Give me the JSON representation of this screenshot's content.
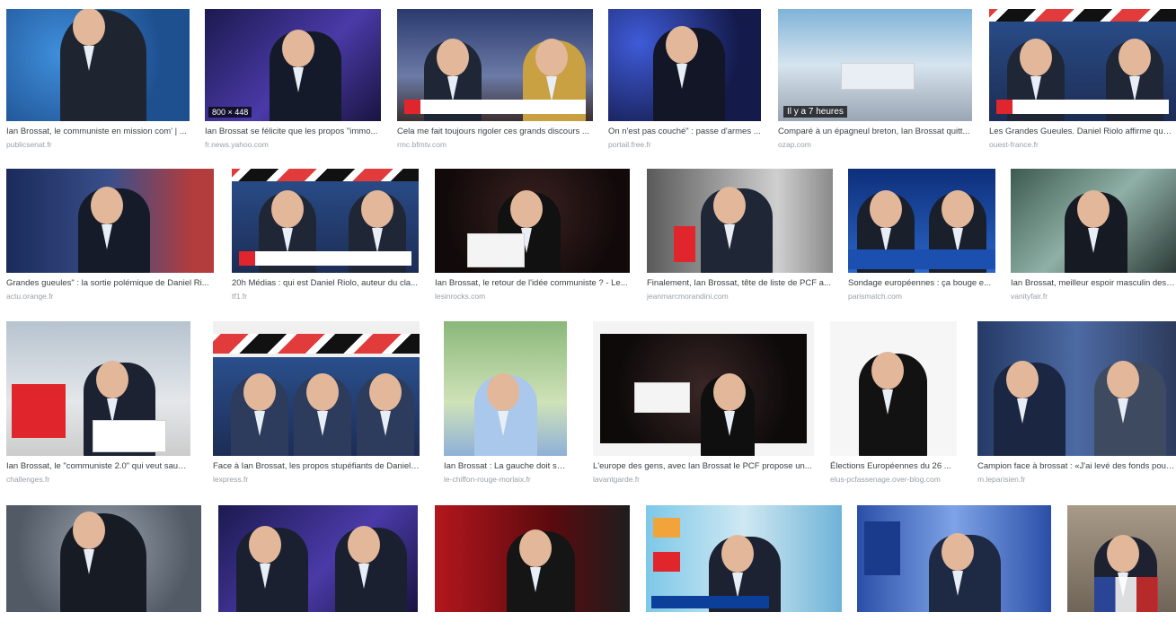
{
  "results": [
    {
      "caption": "Ian Brossat, le communiste en mission com' | ...",
      "source": "publicsenat.fr"
    },
    {
      "caption": "Ian Brossat se félicite que les propos \"immo...",
      "source": "fr.news.yahoo.com",
      "size_badge": "800 × 448"
    },
    {
      "caption": "Cela me fait toujours rigoler ces grands discours ...",
      "source": "rmc.bfmtv.com"
    },
    {
      "caption": "On n'est pas couché\" : passe d'armes ...",
      "source": "portail.free.fr"
    },
    {
      "caption": "Comparé à un épagneul breton, Ian Brossat quitt...",
      "source": "ozap.com",
      "time_badge": "Il y a 7 heures"
    },
    {
      "caption": "Les Grandes Gueules. Daniel Riolo affirme que l...",
      "source": "ouest-france.fr"
    },
    {
      "caption": "Grandes gueules\" : la sortie polémique de Daniel Ri...",
      "source": "actu.orange.fr"
    },
    {
      "caption": "20h Médias : qui est Daniel Riolo, auteur du cla...",
      "source": "tf1.fr"
    },
    {
      "caption": "Ian Brossat, le retour de l'idée communiste ? - Le...",
      "source": "lesinrocks.com"
    },
    {
      "caption": "Finalement, Ian Brossat, tête de liste de PCF a...",
      "source": "jeanmarcmorandini.com"
    },
    {
      "caption": "Sondage européennes : ça bouge e...",
      "source": "parismatch.com"
    },
    {
      "caption": "Ian Brossat, meilleur espoir masculin des é...",
      "source": "vanityfair.fr"
    },
    {
      "caption": "Ian Brossat, le \"communiste 2.0\" qui veut sauve...",
      "source": "challenges.fr"
    },
    {
      "caption": "Face à Ian Brossat, les propos stupéfiants de Daniel ...",
      "source": "lexpress.fr"
    },
    {
      "caption": "Ian Brossat : La gauche doit s'as...",
      "source": "le-chiffon-rouge-morlaix.fr"
    },
    {
      "caption": "L'europe des gens, avec Ian Brossat le PCF propose un...",
      "source": "lavantgarde.fr"
    },
    {
      "caption": "Élections Européennes du 26 ...",
      "source": "elus-pcfassenage.over-blog.com"
    },
    {
      "caption": "Campion face à brossat : «J'ai levé des fonds pour le...",
      "source": "m.leparisien.fr"
    },
    {
      "caption": "",
      "source": ""
    },
    {
      "caption": "",
      "source": ""
    },
    {
      "caption": "",
      "source": ""
    },
    {
      "caption": "",
      "source": ""
    },
    {
      "caption": "",
      "source": ""
    },
    {
      "caption": "",
      "source": ""
    }
  ]
}
